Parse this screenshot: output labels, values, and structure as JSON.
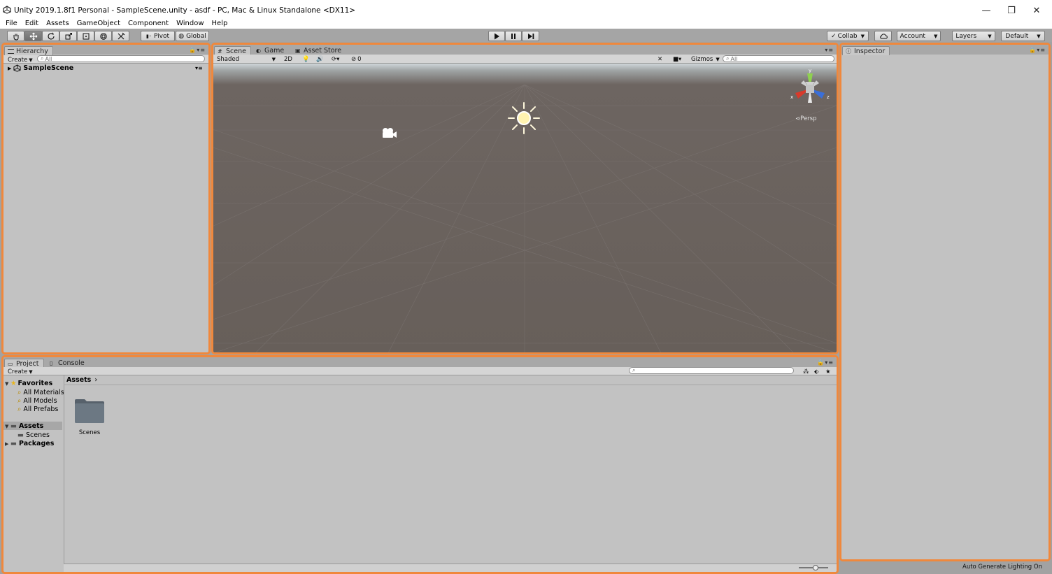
{
  "window": {
    "title": "Unity 2019.1.8f1 Personal - SampleScene.unity - asdf - PC, Mac & Linux Standalone <DX11>",
    "minimize": "—",
    "restore": "❐",
    "close": "✕"
  },
  "menu": [
    "File",
    "Edit",
    "Assets",
    "GameObject",
    "Component",
    "Window",
    "Help"
  ],
  "toolbar": {
    "pivot": "Pivot",
    "global": "Global",
    "collab": "Collab",
    "account": "Account",
    "layers": "Layers",
    "layout": "Default"
  },
  "hierarchy": {
    "tab": "Hierarchy",
    "create": "Create",
    "search_placeholder": "All",
    "scene_name": "SampleScene"
  },
  "scene": {
    "tabs": [
      "Scene",
      "Game",
      "Asset Store"
    ],
    "shading": "Shaded",
    "mode_2d": "2D",
    "hidden_count": "0",
    "gizmos": "Gizmos",
    "search_placeholder": "All",
    "projection": "Persp",
    "axes": {
      "x": "x",
      "y": "y",
      "z": "z"
    }
  },
  "inspector": {
    "tab": "Inspector"
  },
  "project": {
    "tabs": [
      "Project",
      "Console"
    ],
    "create": "Create",
    "favorites": "Favorites",
    "favorite_items": [
      "All Materials",
      "All Models",
      "All Prefabs"
    ],
    "assets": "Assets",
    "asset_children": [
      "Scenes"
    ],
    "packages": "Packages",
    "breadcrumb": "Assets",
    "files": [
      {
        "name": "Scenes"
      }
    ]
  },
  "status": {
    "text": "Auto Generate Lighting On"
  },
  "colors": {
    "panel_border": "#f0883c",
    "scene_ground": "#675f5a",
    "panel_bg": "#c2c2c2"
  }
}
